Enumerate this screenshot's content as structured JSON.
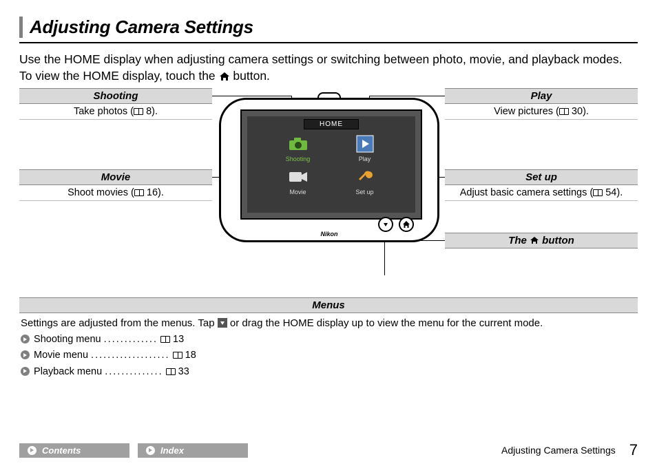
{
  "title": "Adjusting Camera Settings",
  "intro_before": "Use the HOME display when adjusting camera settings or switching between photo, movie, and playback modes. To view the HOME display, touch the ",
  "intro_after": " button.",
  "labels": {
    "shooting": {
      "head": "Shooting",
      "body_before": "Take photos (",
      "page": "8",
      "body_after": ")."
    },
    "play": {
      "head": "Play",
      "body_before": "View pictures (",
      "page": "30",
      "body_after": ")."
    },
    "movie": {
      "head": "Movie",
      "body_before": "Shoot movies (",
      "page": "16",
      "body_after": ")."
    },
    "setup": {
      "head": "Set up",
      "body_before": "Adjust basic camera settings (",
      "page": "54",
      "body_after": ")."
    },
    "homebtn": {
      "head_before": "The ",
      "head_after": " button"
    }
  },
  "camera": {
    "home_label": "HOME",
    "shooting_label": "Shooting",
    "play_label": "Play",
    "movie_label": "Movie",
    "setup_label": "Set up",
    "brand": "Nikon"
  },
  "menus": {
    "head": "Menus",
    "body_before": "Settings are adjusted from the menus. Tap ",
    "body_after": " or drag the HOME display up to view the menu for the current mode.",
    "items": [
      {
        "label": "Shooting menu",
        "dots": ".............",
        "page": "13"
      },
      {
        "label": "Movie menu",
        "dots": "...................",
        "page": "18"
      },
      {
        "label": "Playback menu",
        "dots": "..............",
        "page": "33"
      }
    ]
  },
  "footer": {
    "contents": "Contents",
    "index": "Index",
    "section": "Adjusting Camera Settings",
    "page": "7"
  }
}
